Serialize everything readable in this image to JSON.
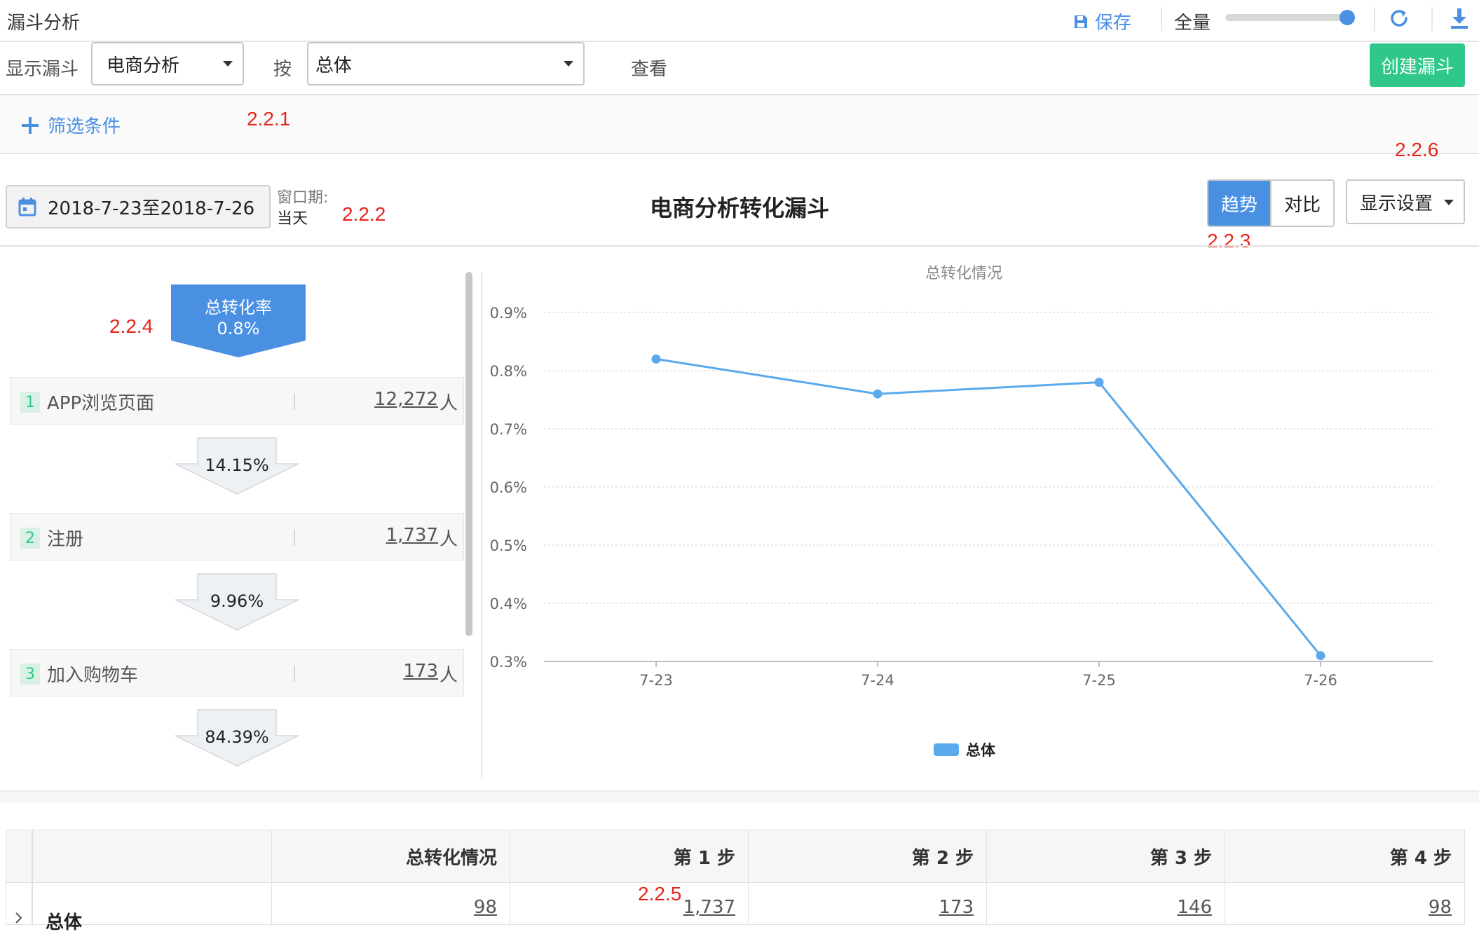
{
  "toolbar": {
    "title": "漏斗分析",
    "save_label": "保存",
    "scope_label": "全量",
    "scope_slider_value": 1.0
  },
  "query": {
    "show_funnel_label": "显示漏斗",
    "funnel_value": "电商分析",
    "by_label": "按",
    "by_value": "总体",
    "view_label": "查看",
    "create_label": "创建漏斗"
  },
  "filter": {
    "add_label": "筛选条件"
  },
  "settings": {
    "date_range": "2018-7-23至2018-7-26",
    "window_label": "窗口期:",
    "window_value": "当天",
    "chart_title": "电商分析转化漏斗",
    "tabs": [
      "趋势",
      "对比"
    ],
    "active_tab": "趋势",
    "display_settings_label": "显示设置"
  },
  "funnel": {
    "total_rate_label": "总转化率",
    "total_rate_value": "0.8%",
    "steps": [
      {
        "num": "1",
        "name": "APP浏览页面",
        "count": "12,272",
        "unit": "人"
      },
      {
        "num": "2",
        "name": "注册",
        "count": "1,737",
        "unit": "人"
      },
      {
        "num": "3",
        "name": "加入购物车",
        "count": "173",
        "unit": "人"
      }
    ],
    "conversions": [
      "14.15%",
      "9.96%",
      "84.39%"
    ]
  },
  "chart_data": {
    "type": "line",
    "title": "总转化情况",
    "x": [
      "7-23",
      "7-24",
      "7-25",
      "7-26"
    ],
    "series": [
      {
        "name": "总体",
        "values": [
          0.82,
          0.76,
          0.78,
          0.31
        ]
      }
    ],
    "ylim": [
      0.3,
      0.9
    ],
    "yticks": [
      "0.9%",
      "0.8%",
      "0.7%",
      "0.6%",
      "0.5%",
      "0.4%",
      "0.3%"
    ],
    "grid": true,
    "legend": "bottom-center",
    "color": "#5aa9ec"
  },
  "table": {
    "headers": [
      "总转化情况",
      "第 1 步",
      "第 2 步",
      "第 3 步",
      "第 4 步"
    ],
    "rows": [
      {
        "label": "总体",
        "values": [
          "98",
          "1,737",
          "173",
          "146",
          "98"
        ]
      }
    ]
  },
  "annotations": [
    "2.2.1",
    "2.2.2",
    "2.2.3",
    "2.2.4",
    "2.2.5",
    "2.2.6"
  ],
  "colors": {
    "accent": "#4a90e2",
    "create": "#2fc88a",
    "annotation": "#e8231b"
  }
}
